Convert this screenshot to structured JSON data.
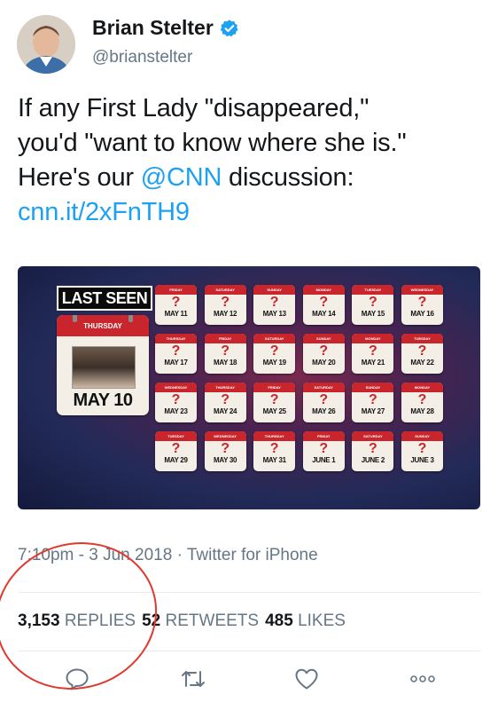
{
  "author": {
    "name": "Brian Stelter",
    "handle": "@brianstelter"
  },
  "tweet": {
    "line1": "If any First Lady \"disappeared,\"",
    "line2": "you'd \"want to know where she is.\"",
    "line3_prefix": "Here's our ",
    "line3_mention": "@CNN",
    "line3_suffix": " discussion:",
    "line4_link": "cnn.it/2xFnTH9"
  },
  "media": {
    "last_seen_label": "LAST SEEN",
    "big_day": "THURSDAY",
    "big_date": "MAY 10",
    "calendars": [
      {
        "day": "FRIDAY",
        "date": "MAY 11"
      },
      {
        "day": "SATURDAY",
        "date": "MAY 12"
      },
      {
        "day": "SUNDAY",
        "date": "MAY 13"
      },
      {
        "day": "MONDAY",
        "date": "MAY 14"
      },
      {
        "day": "TUESDAY",
        "date": "MAY 15"
      },
      {
        "day": "WEDNESDAY",
        "date": "MAY 16"
      },
      {
        "day": "THURSDAY",
        "date": "MAY 17"
      },
      {
        "day": "FRIDAY",
        "date": "MAY 18"
      },
      {
        "day": "SATURDAY",
        "date": "MAY 19"
      },
      {
        "day": "SUNDAY",
        "date": "MAY 20"
      },
      {
        "day": "MONDAY",
        "date": "MAY 21"
      },
      {
        "day": "TUESDAY",
        "date": "MAY 22"
      },
      {
        "day": "WEDNESDAY",
        "date": "MAY 23"
      },
      {
        "day": "THURSDAY",
        "date": "MAY 24"
      },
      {
        "day": "FRIDAY",
        "date": "MAY 25"
      },
      {
        "day": "SATURDAY",
        "date": "MAY 26"
      },
      {
        "day": "SUNDAY",
        "date": "MAY 27"
      },
      {
        "day": "MONDAY",
        "date": "MAY 28"
      },
      {
        "day": "TUESDAY",
        "date": "MAY 29"
      },
      {
        "day": "WEDNESDAY",
        "date": "MAY 30"
      },
      {
        "day": "THURSDAY",
        "date": "MAY 31"
      },
      {
        "day": "FRIDAY",
        "date": "JUNE 1"
      },
      {
        "day": "SATURDAY",
        "date": "JUNE 2"
      },
      {
        "day": "SUNDAY",
        "date": "JUNE 3"
      }
    ],
    "question_mark": "?"
  },
  "meta": {
    "time": "7:10pm",
    "separator": " - ",
    "date": "3 Jun 2018",
    "dot": " · ",
    "client": "Twitter for iPhone"
  },
  "stats": {
    "replies_count": "3,153",
    "replies_label": "REPLIES",
    "retweets_count": "52",
    "retweets_label": "RETWEETS",
    "likes_count": "485",
    "likes_label": "LIKES"
  },
  "icons": {
    "verified": "verified-badge-icon",
    "reply": "reply-icon",
    "retweet": "retweet-icon",
    "like": "heart-icon",
    "more": "more-icon"
  },
  "colors": {
    "link": "#1da1f2",
    "accent_circle": "#e03a2e",
    "calendar_red": "#c8262c"
  }
}
